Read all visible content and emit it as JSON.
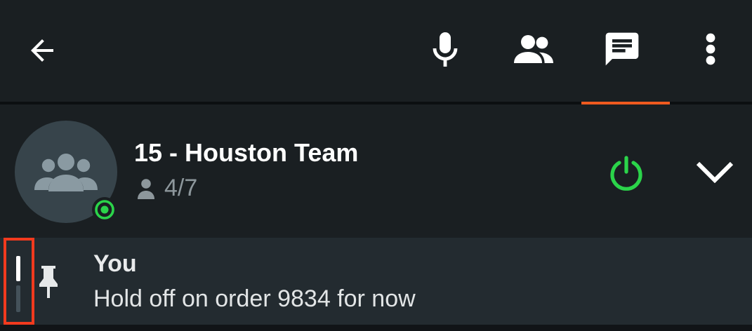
{
  "toolbar": {
    "back_icon": "arrow-left-icon",
    "mic_icon": "microphone-icon",
    "members_icon": "people-icon",
    "chat_icon": "chat-icon",
    "more_icon": "more-vert-icon",
    "active_tab": "chat",
    "accent_color": "#ef5a1f"
  },
  "channel": {
    "title": "15 - Houston Team",
    "members_count": "4/7",
    "avatar_icon": "group-icon",
    "status_icon": "status-online-icon",
    "status_color": "#2bd44a",
    "power_icon": "power-icon",
    "power_color": "#2bd44a",
    "expand_icon": "chevron-down-icon"
  },
  "message": {
    "sender": "You",
    "text": "Hold off on order 9834 for now",
    "pin_icon": "pin-icon",
    "indicator_color": "#f23a1e"
  }
}
